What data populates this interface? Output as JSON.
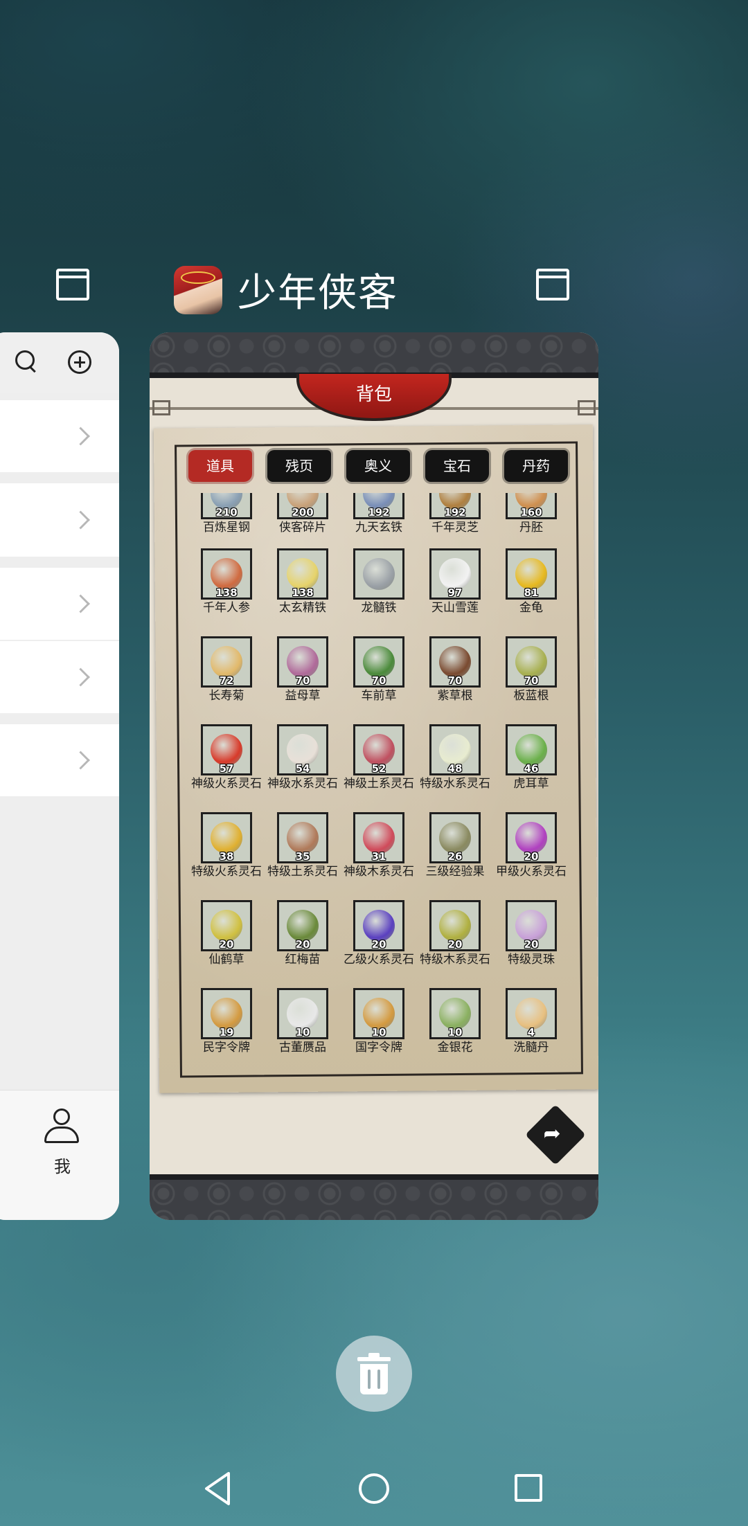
{
  "recents": {
    "app_title": "少年侠客",
    "left_card": {
      "me_label": "我"
    },
    "game_card": {
      "banner": "背包",
      "tabs": [
        "道具",
        "残页",
        "奥义",
        "宝石",
        "丹药"
      ],
      "active_tab": "道具",
      "items": [
        {
          "count": "210",
          "name": "百炼星钢",
          "color": "#8aa0b4"
        },
        {
          "count": "200",
          "name": "侠客碎片",
          "color": "#c9a27a"
        },
        {
          "count": "192",
          "name": "九天玄铁",
          "color": "#7a8fb8"
        },
        {
          "count": "192",
          "name": "千年灵芝",
          "color": "#b08040"
        },
        {
          "count": "160",
          "name": "丹胚",
          "color": "#d09050"
        },
        {
          "count": "138",
          "name": "千年人参",
          "color": "#d06a40"
        },
        {
          "count": "138",
          "name": "太玄精铁",
          "color": "#e6d36a"
        },
        {
          "count": "",
          "name": "龙髓铁",
          "color": "#9aa0a6"
        },
        {
          "count": "97",
          "name": "天山雪莲",
          "color": "#f2f2f2"
        },
        {
          "count": "81",
          "name": "金龟",
          "color": "#e7b91f"
        },
        {
          "count": "72",
          "name": "长寿菊",
          "color": "#e2b96a"
        },
        {
          "count": "70",
          "name": "益母草",
          "color": "#b06a9a"
        },
        {
          "count": "70",
          "name": "车前草",
          "color": "#4a8a3a"
        },
        {
          "count": "70",
          "name": "紫草根",
          "color": "#7a4a30"
        },
        {
          "count": "70",
          "name": "板蓝根",
          "color": "#a8b050"
        },
        {
          "count": "57",
          "name": "神级火系灵石",
          "color": "#d83a2a"
        },
        {
          "count": "54",
          "name": "神级水系灵石",
          "color": "#e8e0d8"
        },
        {
          "count": "52",
          "name": "神级土系灵石",
          "color": "#c05060"
        },
        {
          "count": "48",
          "name": "特级水系灵石",
          "color": "#e8ecd0"
        },
        {
          "count": "46",
          "name": "虎耳草",
          "color": "#6ab04a"
        },
        {
          "count": "38",
          "name": "特级火系灵石",
          "color": "#e0b030"
        },
        {
          "count": "35",
          "name": "特级土系灵石",
          "color": "#b07a5a"
        },
        {
          "count": "31",
          "name": "神级木系灵石",
          "color": "#d04a5a"
        },
        {
          "count": "26",
          "name": "三级经验果",
          "color": "#8a8a60"
        },
        {
          "count": "20",
          "name": "甲级火系灵石",
          "color": "#b040c0"
        },
        {
          "count": "20",
          "name": "仙鹤草",
          "color": "#d0c040"
        },
        {
          "count": "20",
          "name": "红梅苗",
          "color": "#6a8a3a"
        },
        {
          "count": "20",
          "name": "乙级火系灵石",
          "color": "#5a40c0"
        },
        {
          "count": "20",
          "name": "特级木系灵石",
          "color": "#b0b040"
        },
        {
          "count": "20",
          "name": "特级灵珠",
          "color": "#c8a0d8"
        },
        {
          "count": "19",
          "name": "民字令牌",
          "color": "#d49a40"
        },
        {
          "count": "10",
          "name": "古董赝品",
          "color": "#e8e8e8"
        },
        {
          "count": "10",
          "name": "国字令牌",
          "color": "#d49a40"
        },
        {
          "count": "10",
          "name": "金银花",
          "color": "#8ab060"
        },
        {
          "count": "4",
          "name": "洗髓丹",
          "color": "#e8c080"
        }
      ]
    }
  },
  "icons": {
    "window": "window-icon",
    "search": "search-icon",
    "add": "add-circle-icon",
    "person": "person-icon",
    "share": "share-arrow-icon",
    "trash": "trash-icon",
    "back": "nav-back-icon",
    "home": "nav-home-icon",
    "recent": "nav-recent-icon"
  }
}
